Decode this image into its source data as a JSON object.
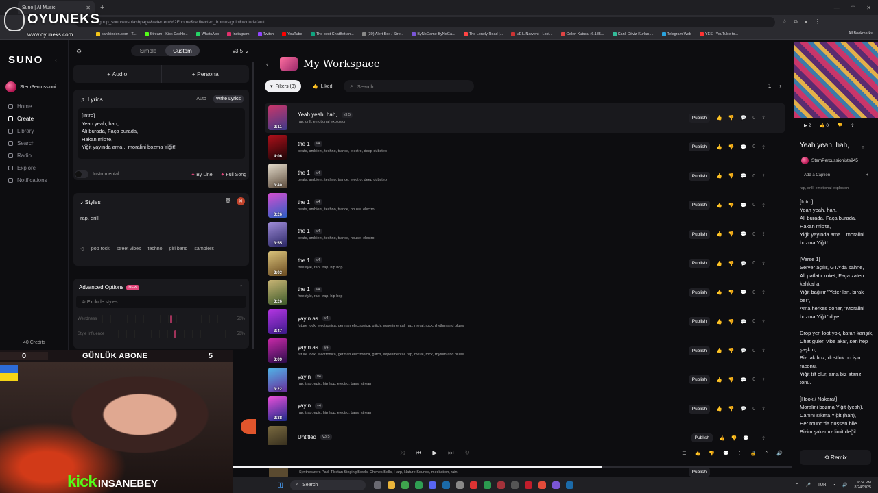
{
  "browser": {
    "tab_title": "Suno | AI Music",
    "url": "...signup_source=splashpage&referrer=%2Fhome&redirected_from=signin&wid=default",
    "bookmarks": [
      "sahibinden.com - T...",
      "Stream - Kick Dashb...",
      "WhatsApp",
      "Instagram",
      "Twitch",
      "YouTube",
      "The best ChatBot an...",
      "(30) Alert Box / Stre...",
      "ByNoGame ByNoGa...",
      "The Lonely Road |...",
      "VEIL Narvent - Lost...",
      "Gelen Kutusu (6.185...",
      "Canlı Döviz Kurları,...",
      "Telegram Web",
      "YES - YouTube to..."
    ],
    "all_bookmarks": "All Bookmarks"
  },
  "overlay": {
    "brand": "OYUNEKS",
    "site": "www.oyuneks.com"
  },
  "sidebar": {
    "logo": "SUNO",
    "user": "StemPercussioni",
    "nav": [
      "Home",
      "Create",
      "Library",
      "Search",
      "Radio",
      "Explore",
      "Notifications"
    ],
    "active": "Create",
    "credits": "40 Credits"
  },
  "create": {
    "mode_simple": "Simple",
    "mode_custom": "Custom",
    "version": "v3.5",
    "audio_label": "Audio",
    "persona_label": "Persona",
    "lyrics_label": "Lyrics",
    "auto_label": "Auto",
    "write_lyrics_label": "Write Lyrics",
    "lyrics_text": "[Intro]\nYeah yeah, hah,\nAli burada, Faça burada,\nHakan mic'te,\nYiğit yayında ama... moralini bozma Yiğit!\n\n[Verse 1]",
    "instrumental_label": "Instrumental",
    "by_line_label": "By Line",
    "full_song_label": "Full Song",
    "styles_label": "Styles",
    "styles_text": "rap, drill,",
    "style_chips": [
      "pop rock",
      "street vibes",
      "techno",
      "girl band",
      "samplers"
    ],
    "advanced_label": "Advanced Options",
    "new_badge": "NEW",
    "exclude_label": "Exclude styles",
    "weirdness_label": "Weirdness",
    "weirdness_value": "50%",
    "weirdness_level": 0.5,
    "style_influence_label": "Style Influence",
    "style_influence_value": "50%",
    "style_influence_level": 0.5
  },
  "workspace": {
    "title": "My Workspace",
    "filters_label": "Filters (3)",
    "liked_label": "Liked",
    "search_placeholder": "Search",
    "page": "1",
    "publish_label": "Publish",
    "songs": [
      {
        "title": "Yeah yeah, hah,",
        "ver": "v3.5",
        "tags": "rap, drill, emotional explosion",
        "dur": "2:11",
        "count": "0",
        "colors": [
          "#c9366a",
          "#3d3a8a"
        ]
      },
      {
        "title": "the 1",
        "ver": "v4",
        "tags": "beats, ambient, techno, trance, electro, deep dubstep",
        "dur": "4:06",
        "count": "0",
        "colors": [
          "#b0101a",
          "#1a0507"
        ]
      },
      {
        "title": "the 1",
        "ver": "v4",
        "tags": "beats, ambient, techno, trance, electro, deep dubstep",
        "dur": "3:40",
        "count": "0",
        "colors": [
          "#e4dccc",
          "#5b4a3a"
        ]
      },
      {
        "title": "the 1",
        "ver": "v4",
        "tags": "beats, ambient, techno, trance, house, electro",
        "dur": "3:26",
        "count": "0",
        "colors": [
          "#d44fd0",
          "#2a5fc4"
        ]
      },
      {
        "title": "the 1",
        "ver": "v4",
        "tags": "beats, ambient, techno, trance, house, electro",
        "dur": "3:55",
        "count": "0",
        "colors": [
          "#9f8cd8",
          "#2b2766"
        ]
      },
      {
        "title": "the 1",
        "ver": "v4",
        "tags": "freestyle, rap, trap, hip hop",
        "dur": "2:03",
        "count": "0",
        "colors": [
          "#d9c27a",
          "#6a4a20"
        ]
      },
      {
        "title": "the 1",
        "ver": "v4",
        "tags": "freestyle, rap, trap, hip hop",
        "dur": "3:26",
        "count": "0",
        "colors": [
          "#c8b474",
          "#3d5a2a"
        ]
      },
      {
        "title": "yayın as",
        "ver": "v4",
        "tags": "future rock, electronica, german electronica, glitch, experimental, rap, metal, rock, rhythm and blues",
        "dur": "3:47",
        "count": "0",
        "colors": [
          "#b235e0",
          "#3a1a8a"
        ]
      },
      {
        "title": "yayın as",
        "ver": "v4",
        "tags": "future rock, electronica, german electronica, glitch, experimental, rap, metal, rock, rhythm and blues",
        "dur": "3:09",
        "count": "0",
        "colors": [
          "#c82aa8",
          "#2a0b4a"
        ]
      },
      {
        "title": "yayın",
        "ver": "v4",
        "tags": "rap, trap, epic, hip hop, electro, bass, stream",
        "dur": "3:22",
        "count": "0",
        "colors": [
          "#4fb6e8",
          "#6a2a9a"
        ]
      },
      {
        "title": "yayın",
        "ver": "v4",
        "tags": "rap, trap, epic, hip hop, electro, bass, stream",
        "dur": "2:38",
        "count": "0",
        "colors": [
          "#e84fd8",
          "#1a2a8a"
        ]
      },
      {
        "title": "Untitled",
        "ver": "v3.5",
        "tags": "",
        "dur": "",
        "count": "",
        "colors": [
          "#7a6a40",
          "#2a2418"
        ]
      }
    ],
    "last_tags": "Synthesizers Pad, Tibetan Singing Bowls, Chimes Bells, Harp, Nature Sounds, meditation, rain"
  },
  "right": {
    "likes": "2",
    "plays": "0",
    "title": "Yeah yeah, hah,",
    "user": "StemPercussionists945",
    "add_caption": "Add a Caption",
    "tags": "rap, drill, emotional explosion",
    "lyrics": "[Intro]\nYeah yeah, hah,\nAli burada, Faça burada,\nHakan mic'te,\nYiğit yayında ama... moralini bozma Yiğit!\n\n[Verse 1]\nServer açılır, GTA'da sahne,\nAli patlatır roket, Faça zaten kahkaha,\nYiğit bağırır \"Yeter lan, bırak be!\",\nAma herkes döner, \"Moralini bozma Yiğit\" diye.\n\nDrop yer, loot yok, kafan karışık,\nChat güler, vibe akar, sen hep şaşkın,\nBiz takılırız, dostluk bu işin raconu,\nYiğit tilt olur, ama biz atarız tonu.\n\n[Hook / Nakarat]\nMoralini bozma Yiğit (yeah),\nCanını sıkma Yiğit (hah),\nHer round'da düşsen bile\nBizim şakamız limit değil.",
    "remix_label": "Remix"
  },
  "player": {
    "progress": 0.66
  },
  "stream": {
    "count_left": "0",
    "label": "GÜNLÜK ABONE",
    "count_right": "5",
    "kick": "kick",
    "username": "INSANEBEY"
  },
  "taskbar": {
    "search": "Search",
    "lang": "TUR",
    "time": "9:34 PM",
    "date": "8/24/2025"
  }
}
